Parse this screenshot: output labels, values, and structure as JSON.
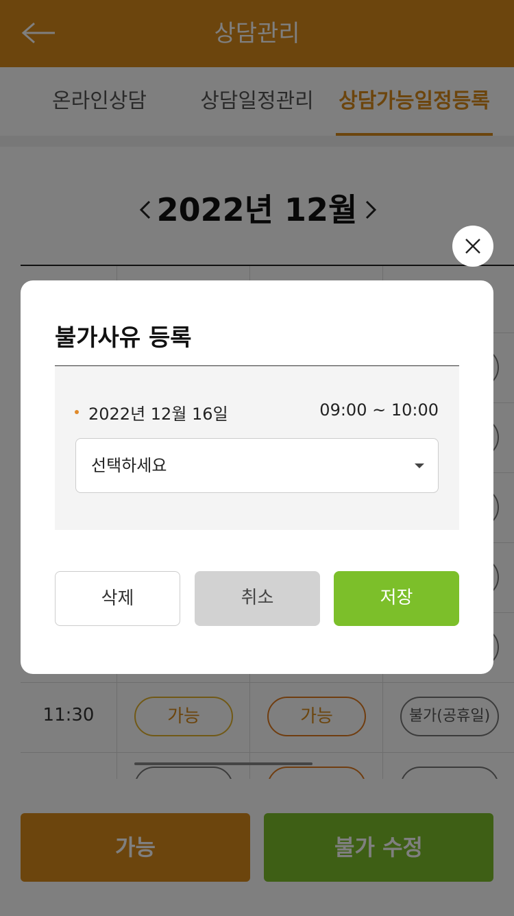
{
  "header": {
    "title": "상담관리"
  },
  "tabs": [
    {
      "label": "온라인상담"
    },
    {
      "label": "상담일정관리"
    },
    {
      "label": "상담가능일정등록"
    }
  ],
  "calendar": {
    "month_title": "2022년 12월",
    "visible_row": {
      "time": "11:30",
      "cells": [
        "가능",
        "가능",
        "불가(공휴일)"
      ]
    }
  },
  "bottom": {
    "available_label": "가능",
    "edit_label": "불가 수정"
  },
  "modal": {
    "title": "불가사유 등록",
    "date": "2022년 12월 16일",
    "time_range": "09:00  ~ 10:00",
    "select_value": "선택하세요",
    "delete_label": "삭제",
    "cancel_label": "취소",
    "save_label": "저장"
  },
  "colors": {
    "header": "#d98a1a",
    "save_button": "#7cbf2a",
    "cancel_button": "#d2d2d2"
  }
}
